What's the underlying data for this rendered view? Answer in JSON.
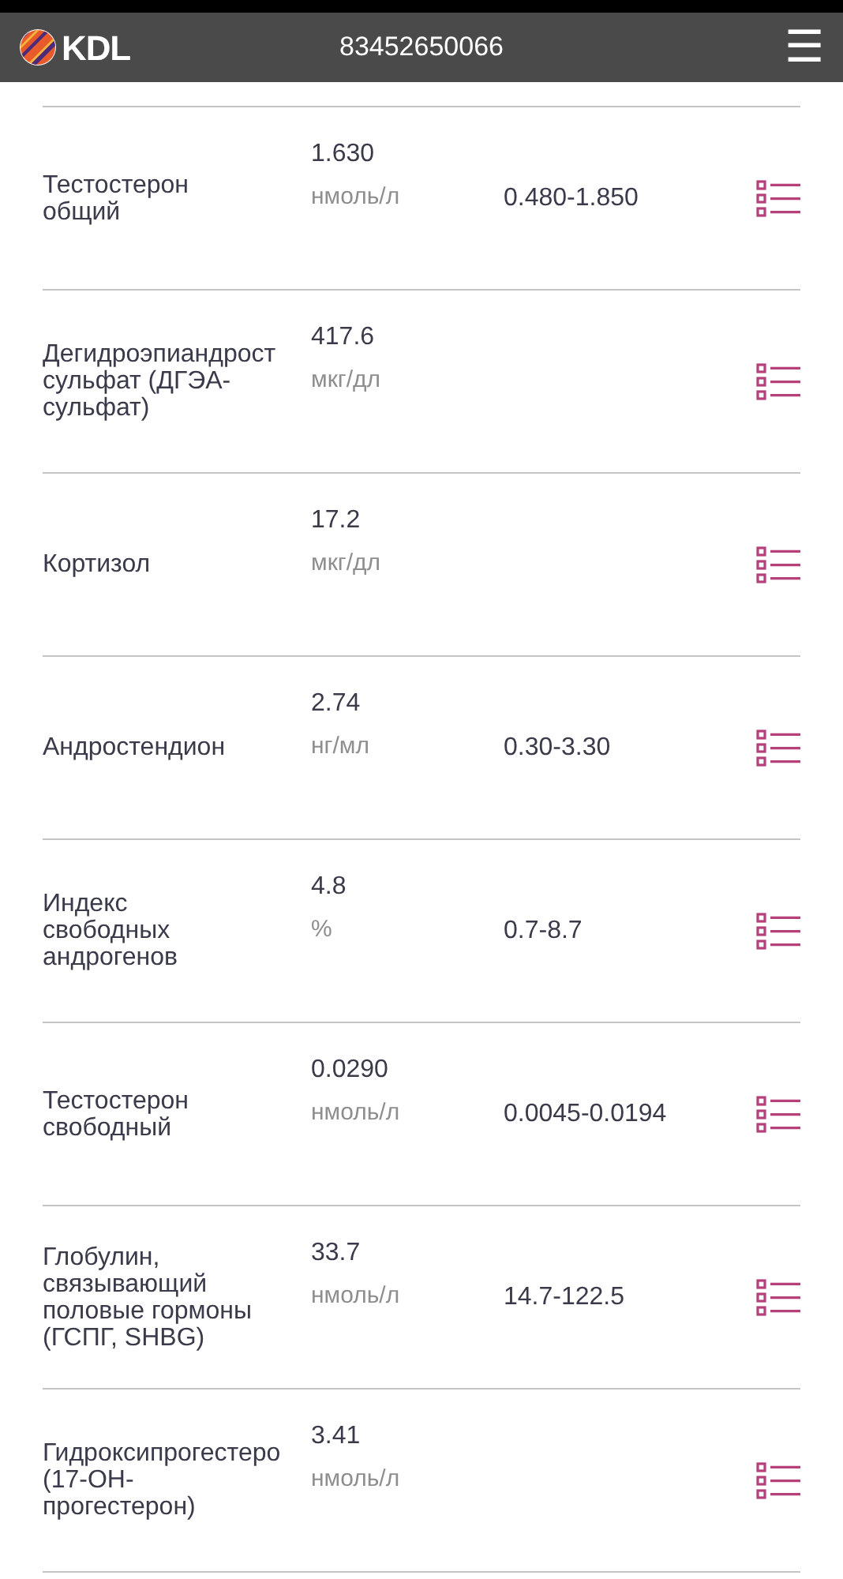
{
  "header": {
    "logo_text": "KDL",
    "phone": "83452650066",
    "menu_icon": "☰"
  },
  "results": [
    {
      "name": "Тестостерон\nобщий",
      "value": "1.630",
      "unit": "нмоль/л",
      "reference": "0.480-1.850"
    },
    {
      "name": "Дегидроэпиандрост сульфат (ДГЭА-сульфат)",
      "value": "417.6",
      "unit": "мкг/дл"
    },
    {
      "name": "Кортизол",
      "value": "17.2",
      "unit": "мкг/дл"
    },
    {
      "name": "Андростендион",
      "value": "2.74",
      "unit": "нг/мл",
      "reference": "0.30-3.30"
    },
    {
      "name": "Индекс\nсвободных\nандрогенов",
      "value": "4.8",
      "unit": "%",
      "reference": "0.7-8.7"
    },
    {
      "name": "Тестостерон свободный",
      "value": "0.0290",
      "unit": "нмоль/л",
      "reference": "0.0045-0.0194"
    },
    {
      "name": "Глобулин, связывающий половые гормоны (ГСПГ, SHBG)",
      "value": "33.7",
      "unit": "нмоль/л",
      "reference": "14.7-122.5"
    },
    {
      "name": "Гидроксипрогестеро\n(17-ОН-\nпрогестерон)",
      "value": "3.41",
      "unit": "нмоль/л"
    }
  ]
}
